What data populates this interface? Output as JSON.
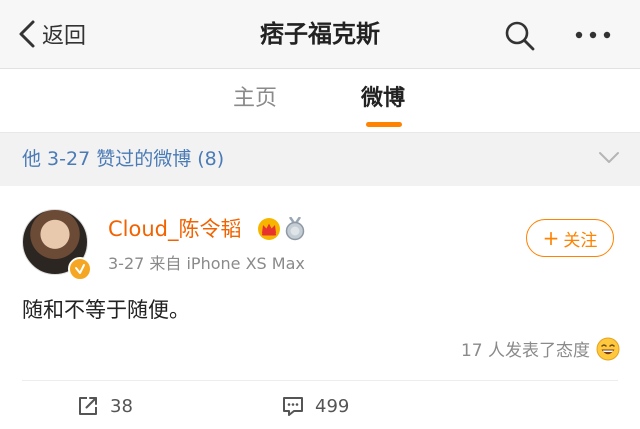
{
  "nav": {
    "back_label": "返回",
    "title": "痞子福克斯"
  },
  "tabs": [
    {
      "label": "主页",
      "active": false
    },
    {
      "label": "微博",
      "active": true
    }
  ],
  "section": {
    "title": "他 3-27 赞过的微博 (8)"
  },
  "post": {
    "author": "Cloud_陈令韬",
    "meta": "3-27  来自 iPhone XS Max",
    "follow_label": "关注",
    "text": "随和不等于随便。",
    "reactions": "17 人发表了态度",
    "reposts": "38",
    "comments": "499"
  },
  "colors": {
    "accent": "#ff8200",
    "username": "#f26200",
    "link": "#4a7bb7"
  },
  "icons": {
    "back": "chevron-left-icon",
    "search": "search-icon",
    "more": "more-icon",
    "section_toggle": "chevron-down-icon",
    "crown": "crown-icon",
    "medal": "medal-icon",
    "verified": "verified-badge-icon",
    "reaction": "laughing-emoji-icon",
    "share": "share-icon",
    "comment": "comment-icon"
  }
}
